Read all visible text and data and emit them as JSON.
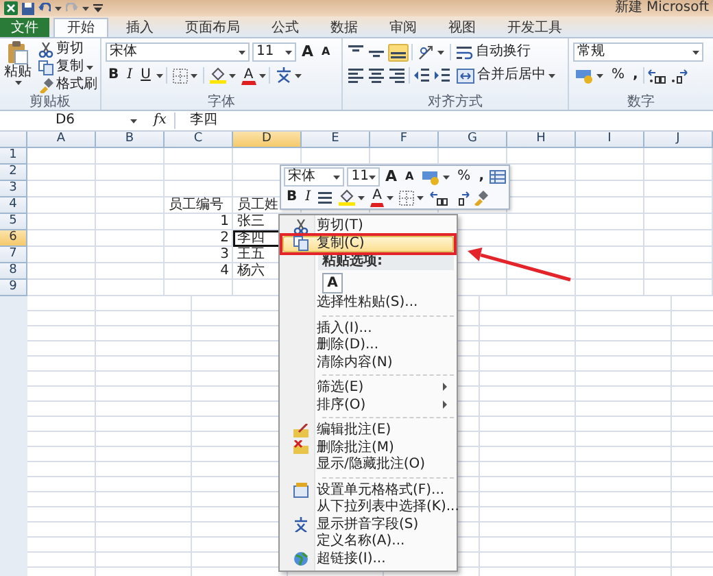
{
  "title_bar": {
    "title": "新建 Microsoft"
  },
  "tabs": [
    {
      "label": "文件",
      "kind": "file",
      "selected": false
    },
    {
      "label": "开始",
      "kind": "tab",
      "selected": true
    },
    {
      "label": "插入",
      "kind": "tab",
      "selected": false
    },
    {
      "label": "页面布局",
      "kind": "tab",
      "selected": false
    },
    {
      "label": "公式",
      "kind": "tab",
      "selected": false
    },
    {
      "label": "数据",
      "kind": "tab",
      "selected": false
    },
    {
      "label": "审阅",
      "kind": "tab",
      "selected": false
    },
    {
      "label": "视图",
      "kind": "tab",
      "selected": false
    },
    {
      "label": "开发工具",
      "kind": "tab",
      "selected": false
    }
  ],
  "clipboard": {
    "paste": "粘贴",
    "cut": "剪切",
    "copy": "复制",
    "format_painter": "格式刷",
    "label": "剪贴板"
  },
  "font": {
    "name": "宋体",
    "size": "11",
    "grow": "A",
    "shrink": "A",
    "bold": "B",
    "italic": "I",
    "underline": "U",
    "font_color": "A",
    "label": "字体"
  },
  "alignment": {
    "wrap_text": "自动换行",
    "merge_center": "合并后居中",
    "label": "对齐方式"
  },
  "number": {
    "format": "常规",
    "percent": "%",
    "comma": ",",
    "label": "数字"
  },
  "formula_bar": {
    "name_box": "D6",
    "function_label": "fx",
    "value": "李四"
  },
  "sheet": {
    "columns": [
      {
        "label": "A",
        "selected": false
      },
      {
        "label": "B",
        "selected": false
      },
      {
        "label": "C",
        "selected": false
      },
      {
        "label": "D",
        "selected": true
      },
      {
        "label": "E",
        "selected": false
      },
      {
        "label": "F",
        "selected": false
      },
      {
        "label": "G",
        "selected": false
      },
      {
        "label": "H",
        "selected": false
      },
      {
        "label": "I",
        "selected": false
      },
      {
        "label": "J",
        "selected": false
      }
    ],
    "rows": [
      {
        "label": "1",
        "selected": false
      },
      {
        "label": "2",
        "selected": false
      },
      {
        "label": "3",
        "selected": false
      },
      {
        "label": "4",
        "selected": false,
        "cells": {
          "C": {
            "text": "员工编号",
            "kind": "text"
          },
          "D": {
            "text": "员工姓",
            "kind": "text"
          }
        }
      },
      {
        "label": "5",
        "selected": false,
        "cells": {
          "C": {
            "text": "1",
            "kind": "number"
          },
          "D": {
            "text": "张三",
            "kind": "text"
          }
        }
      },
      {
        "label": "6",
        "selected": true,
        "cells": {
          "C": {
            "text": "2",
            "kind": "number"
          },
          "D": {
            "text": "李四",
            "kind": "text"
          }
        }
      },
      {
        "label": "7",
        "selected": false,
        "cells": {
          "C": {
            "text": "3",
            "kind": "number"
          },
          "D": {
            "text": "王五",
            "kind": "text"
          }
        }
      },
      {
        "label": "8",
        "selected": false,
        "cells": {
          "C": {
            "text": "4",
            "kind": "number"
          },
          "D": {
            "text": "杨六",
            "kind": "text"
          }
        }
      },
      {
        "label": "9",
        "selected": false
      }
    ]
  },
  "mini_toolbar": {
    "font_name": "宋体",
    "font_size": "11",
    "grow": "A",
    "shrink": "A",
    "percent": "%",
    "comma": ",",
    "bold": "B",
    "italic": "I",
    "font_color": "A"
  },
  "context_menu": {
    "items": [
      {
        "kind": "cut",
        "label": "剪切(T)",
        "selected": false,
        "annotated": false
      },
      {
        "kind": "copy",
        "label": "复制(C)",
        "selected": true,
        "annotated": true
      },
      {
        "kind": "header",
        "label": "粘贴选项:"
      },
      {
        "kind": "paste",
        "label": "A"
      },
      {
        "kind": "item",
        "label": "选择性粘贴(S)...",
        "selected": false,
        "annotated": false
      },
      {
        "kind": "separator"
      },
      {
        "kind": "item",
        "label": "插入(I)...",
        "selected": false,
        "annotated": false
      },
      {
        "kind": "item",
        "label": "删除(D)...",
        "selected": false,
        "annotated": false
      },
      {
        "kind": "item",
        "label": "清除内容(N)",
        "selected": false,
        "annotated": false
      },
      {
        "kind": "separator"
      },
      {
        "kind": "submenu",
        "label": "筛选(E)",
        "selected": false,
        "annotated": false
      },
      {
        "kind": "submenu",
        "label": "排序(O)",
        "selected": false,
        "annotated": false
      },
      {
        "kind": "separator"
      },
      {
        "kind": "edit-comment",
        "label": "编辑批注(E)",
        "selected": false,
        "annotated": false
      },
      {
        "kind": "delete-comment",
        "label": "删除批注(M)",
        "selected": false,
        "annotated": false
      },
      {
        "kind": "item",
        "label": "显示/隐藏批注(O)",
        "selected": false,
        "annotated": false
      },
      {
        "kind": "separator"
      },
      {
        "kind": "format-cells",
        "label": "设置单元格格式(F)...",
        "selected": false,
        "annotated": false
      },
      {
        "kind": "item",
        "label": "从下拉列表中选择(K)...",
        "selected": false,
        "annotated": false
      },
      {
        "kind": "phonetic",
        "label": "显示拼音字段(S)",
        "selected": false,
        "annotated": false
      },
      {
        "kind": "item",
        "label": "定义名称(A)...",
        "selected": false,
        "annotated": false
      },
      {
        "kind": "hyperlink",
        "label": "超链接(I)...",
        "selected": false,
        "annotated": false
      }
    ]
  }
}
